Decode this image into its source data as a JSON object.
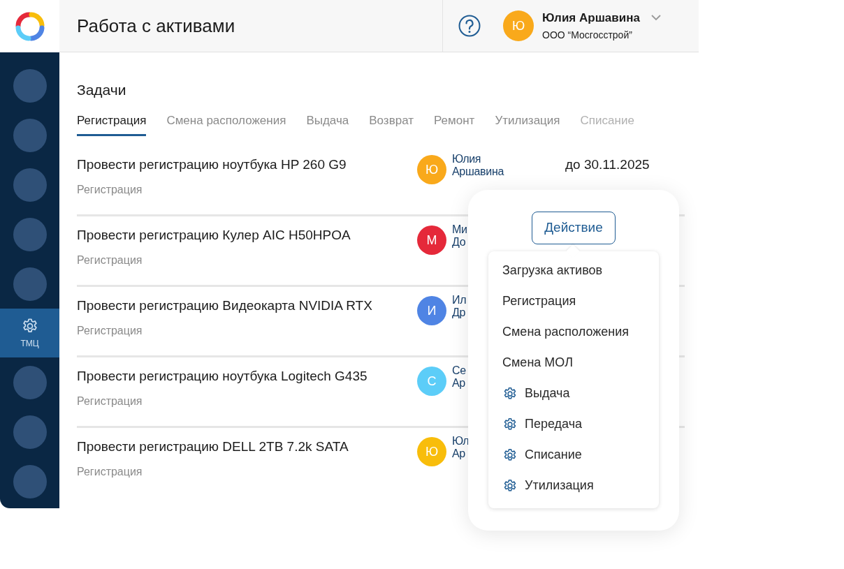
{
  "header": {
    "title": "Работа с активами",
    "user": {
      "initial": "Ю",
      "color": "#f9a91b",
      "name": "Юлия Аршавина",
      "org": "ООО “Мосгосстрой”"
    }
  },
  "sidebar": {
    "items": [
      {
        "kind": "placeholder",
        "selected": false
      },
      {
        "kind": "placeholder",
        "selected": false
      },
      {
        "kind": "placeholder",
        "selected": false
      },
      {
        "kind": "placeholder",
        "selected": false
      },
      {
        "kind": "placeholder",
        "selected": false
      },
      {
        "kind": "nav",
        "label": "ТМЦ",
        "selected": true
      },
      {
        "kind": "placeholder",
        "selected": false
      },
      {
        "kind": "placeholder",
        "selected": false
      },
      {
        "kind": "placeholder",
        "selected": false
      }
    ]
  },
  "section_title": "Задачи",
  "tabs": [
    {
      "label": "Регистрация",
      "selected": true
    },
    {
      "label": "Смена расположения",
      "selected": false
    },
    {
      "label": "Выдача",
      "selected": false
    },
    {
      "label": "Возврат",
      "selected": false
    },
    {
      "label": "Ремонт",
      "selected": false
    },
    {
      "label": "Утилизация",
      "selected": false
    },
    {
      "label": "Списание",
      "selected": false
    }
  ],
  "tasks": [
    {
      "title": "Провести регистрацию ноутбука HP 260 G9",
      "category": "Регистрация",
      "assignee": {
        "initial": "Ю",
        "color": "#f9a91b",
        "name_lines": [
          "Юлия",
          "Аршавина"
        ]
      },
      "due": "до 30.11.2025"
    },
    {
      "title": "Провести регистрацию Кулер AIC H50HPOA",
      "category": "Регистрация",
      "assignee": {
        "initial": "М",
        "color": "#e5293a",
        "name_lines": [
          "Ми",
          "До"
        ]
      }
    },
    {
      "title": "Провести регистрацию Видеокарта NVIDIA RTX",
      "category": "Регистрация",
      "assignee": {
        "initial": "И",
        "color": "#4f84e4",
        "name_lines": [
          "Ил",
          "Др"
        ]
      }
    },
    {
      "title": "Провести регистрацию ноутбука Logitech G435",
      "category": "Регистрация",
      "assignee": {
        "initial": "С",
        "color": "#5ccdf8",
        "name_lines": [
          "Се",
          "Ар"
        ]
      }
    },
    {
      "title": "Провести регистрацию DELL 2TB 7.2k SATA",
      "category": "Регистрация",
      "assignee": {
        "initial": "Ю",
        "color": "#f8bd0b",
        "name_lines": [
          "Юл",
          "Ар"
        ]
      }
    }
  ],
  "action_popup": {
    "button": "Действие",
    "menu": [
      {
        "label": "Загрузка активов",
        "kind": "plain"
      },
      {
        "label": "Регистрация",
        "kind": "plain"
      },
      {
        "label": "Смена расположения",
        "kind": "plain"
      },
      {
        "label": "Смена МОЛ",
        "kind": "plain"
      },
      {
        "label": "Выдача",
        "kind": "gear"
      },
      {
        "label": "Передача",
        "kind": "gear"
      },
      {
        "label": "Списание",
        "kind": "gear"
      },
      {
        "label": "Утилизация",
        "kind": "gear"
      }
    ]
  }
}
